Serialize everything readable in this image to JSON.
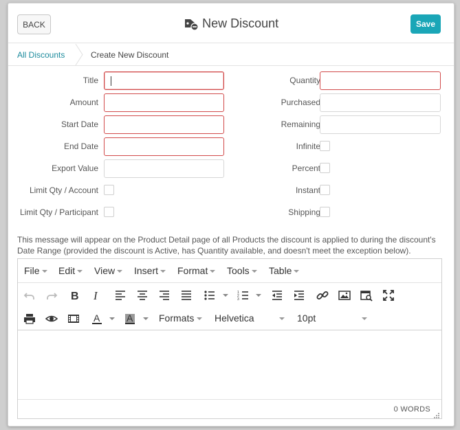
{
  "header": {
    "back_label": "BACK",
    "title": "New Discount",
    "save_label": "Save",
    "accent_color": "#1aa6b7"
  },
  "breadcrumb": {
    "link": "All Discounts",
    "current": "Create New Discount"
  },
  "form": {
    "left": {
      "title": "Title",
      "amount": "Amount",
      "start_date": "Start Date",
      "end_date": "End Date",
      "export_value": "Export Value",
      "limit_qty_account": "Limit Qty / Account",
      "limit_qty_participant": "Limit Qty / Participant"
    },
    "right": {
      "quantity": "Quantity",
      "purchased": "Purchased",
      "remaining": "Remaining",
      "infinite": "Infinite",
      "percent": "Percent",
      "instant": "Instant",
      "shipping": "Shipping"
    },
    "required_border_color": "#d14a4a"
  },
  "note": "This message will appear on the Product Detail page of all Products the discount is applied to during the discount's Date Range (provided the discount is Active, has Quantity available, and doesn't meet the exception below).",
  "editor": {
    "menus": [
      "File",
      "Edit",
      "View",
      "Insert",
      "Format",
      "Tools",
      "Table"
    ],
    "formats_label": "Formats",
    "font_family": "Helvetica",
    "font_size": "10pt",
    "word_count": "0 WORDS"
  }
}
